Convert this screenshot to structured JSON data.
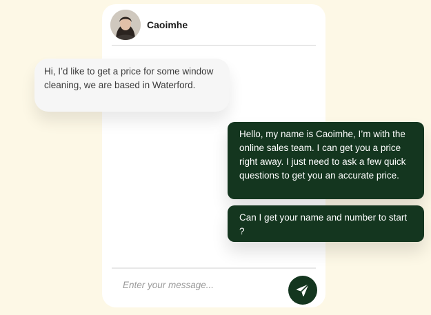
{
  "chat": {
    "contact_name": "Caoimhe",
    "messages": [
      {
        "sender": "customer",
        "text": "Hi, I’d like to get a price for some window cleaning, we are based in Waterford."
      },
      {
        "sender": "agent",
        "text": "Hello, my name is Caoimhe, I’m with the online sales team. I can get you a price right away. I just need to ask a few quick questions to get you an accurate price."
      },
      {
        "sender": "agent",
        "text": "Can I get your name and number to start ?"
      }
    ],
    "input": {
      "placeholder": "Enter your message...",
      "value": ""
    },
    "send_icon": "paper-plane-icon"
  },
  "colors": {
    "page_background": "#fdf8e6",
    "agent_bubble": "#14361f",
    "customer_bubble": "#f6f6f6",
    "send_button": "#14361f"
  }
}
